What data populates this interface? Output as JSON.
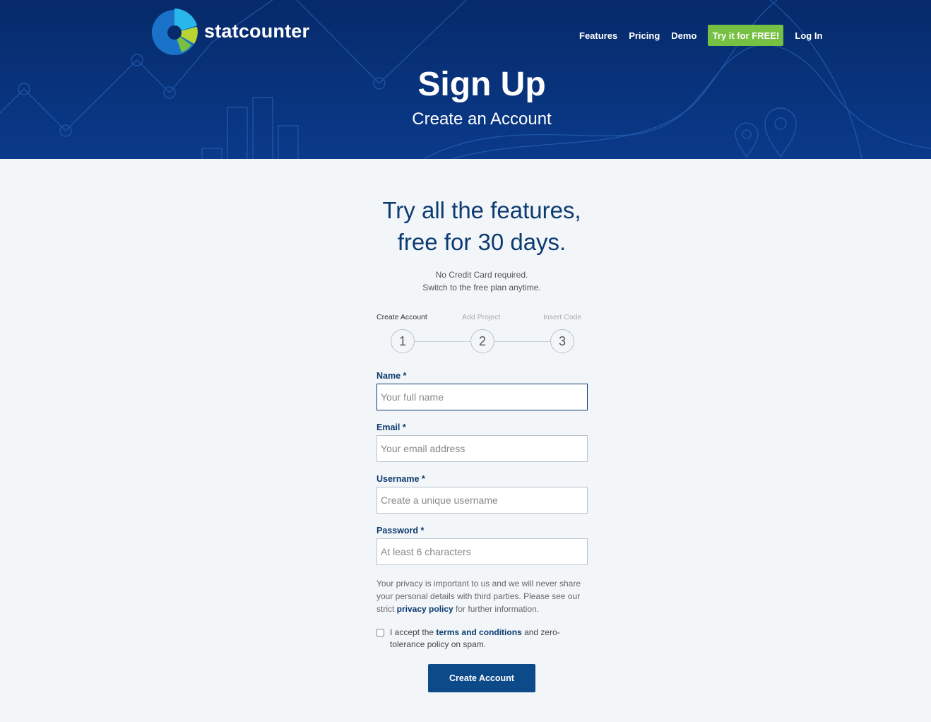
{
  "brand": {
    "name": "statcounter"
  },
  "nav": {
    "features": "Features",
    "pricing": "Pricing",
    "demo": "Demo",
    "cta": "Try it for FREE!",
    "login": "Log In"
  },
  "hero": {
    "title": "Sign Up",
    "subtitle": "Create an Account"
  },
  "tagline": {
    "line1": "Try all the features,",
    "line2": "free for 30 days."
  },
  "note": {
    "line1": "No Credit Card required.",
    "line2": "Switch to the free plan anytime."
  },
  "steps": [
    {
      "label": "Create Account",
      "number": "1"
    },
    {
      "label": "Add Project",
      "number": "2"
    },
    {
      "label": "Insert Code",
      "number": "3"
    }
  ],
  "form": {
    "name": {
      "label": "Name *",
      "placeholder": "Your full name",
      "value": ""
    },
    "email": {
      "label": "Email *",
      "placeholder": "Your email address",
      "value": ""
    },
    "username": {
      "label": "Username *",
      "placeholder": "Create a unique username",
      "value": ""
    },
    "password": {
      "label": "Password *",
      "placeholder": "At least 6 characters",
      "value": ""
    },
    "privacy": {
      "before": "Your privacy is important to us and we will never share your personal details with third parties. Please see our strict ",
      "link": "privacy policy",
      "after": " for further information."
    },
    "terms": {
      "before": "I accept the ",
      "link": "terms and conditions",
      "after": " and zero-tolerance policy on spam.",
      "checked": false
    },
    "submit": "Create Account"
  },
  "colors": {
    "hero_bg": "#0a3a8a",
    "accent_green": "#76c043",
    "brand_navy": "#0c3b70",
    "button_blue": "#0c4a8a"
  }
}
